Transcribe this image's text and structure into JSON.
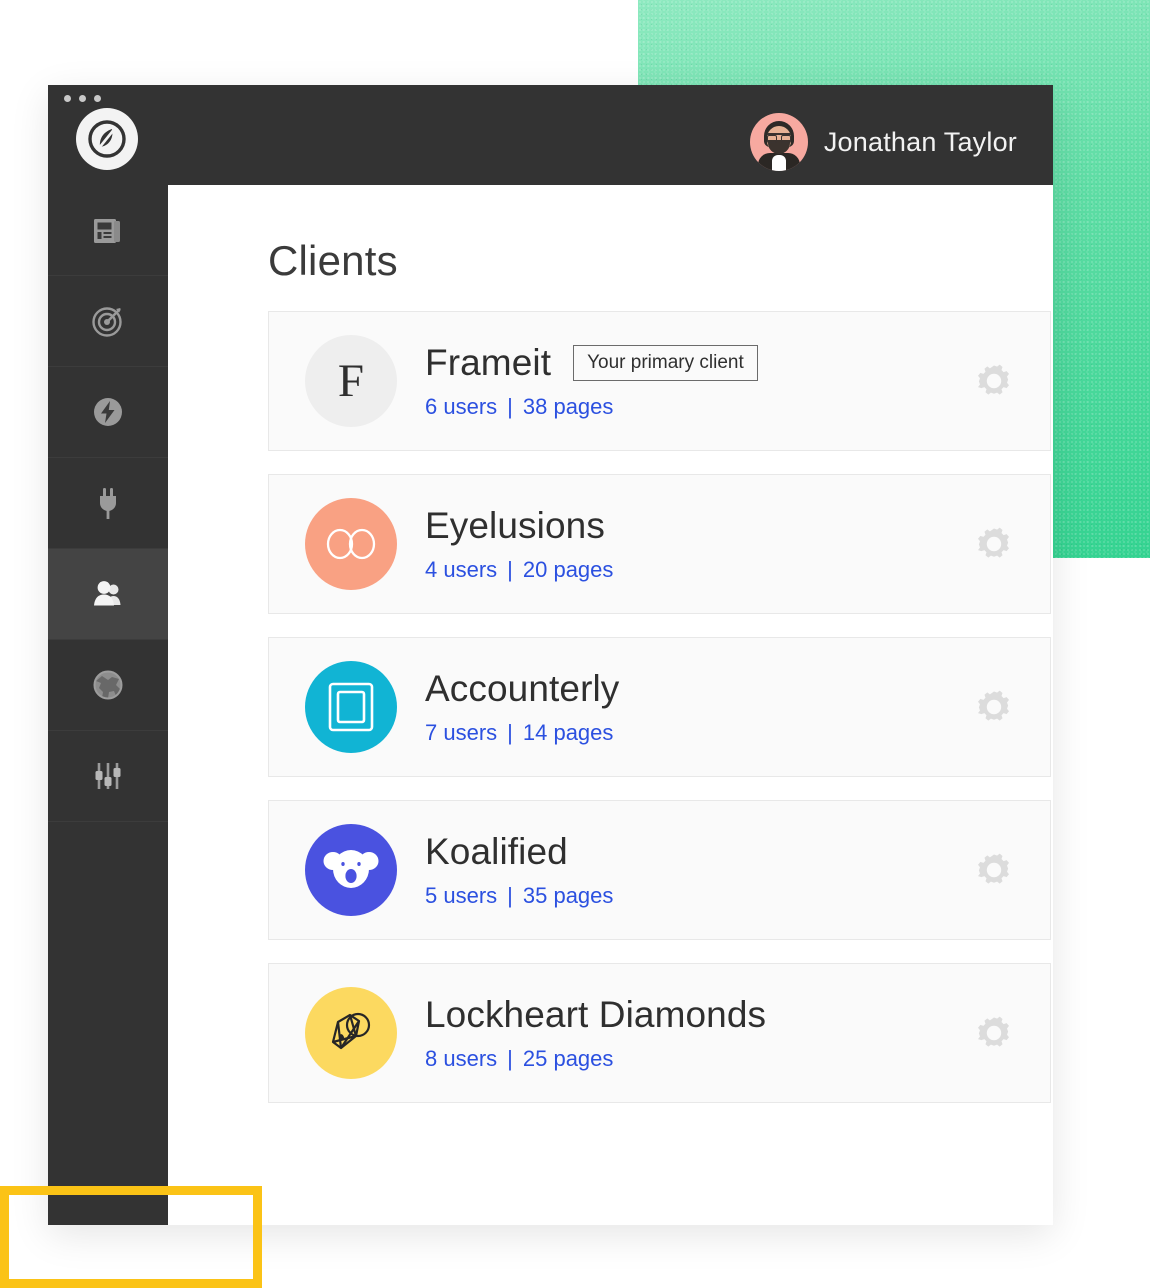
{
  "decor": {
    "green_block_color": "#34d391",
    "yellow_frame_color": "#fbc316"
  },
  "window": {
    "chrome_color": "#333333",
    "dots": [
      "dot",
      "dot",
      "dot"
    ]
  },
  "header": {
    "user_name": "Jonathan Taylor",
    "avatar_bg": "#f7a9a0"
  },
  "sidebar": {
    "logo_name": "app-logo",
    "items": [
      {
        "icon": "newspaper-icon",
        "name": "sidebar-item-content",
        "active": false
      },
      {
        "icon": "target-icon",
        "name": "sidebar-item-goals",
        "active": false
      },
      {
        "icon": "lightning-icon",
        "name": "sidebar-item-automation",
        "active": false
      },
      {
        "icon": "plug-icon",
        "name": "sidebar-item-integrations",
        "active": false
      },
      {
        "icon": "people-icon",
        "name": "sidebar-item-clients",
        "active": true
      },
      {
        "icon": "globe-icon",
        "name": "sidebar-item-sites",
        "active": false
      },
      {
        "icon": "sliders-icon",
        "name": "sidebar-item-settings",
        "active": false
      }
    ]
  },
  "main": {
    "title": "Clients",
    "gear_label": "gear-icon",
    "separator": "|",
    "clients": [
      {
        "name": "Frameit",
        "badge": "Your primary client",
        "users": "6 users",
        "pages": "38 pages",
        "logo_bg": "#eeeeee",
        "logo_type": "letter-f"
      },
      {
        "name": "Eyelusions",
        "badge": "",
        "users": "4 users",
        "pages": "20 pages",
        "logo_bg": "#f9a183",
        "logo_type": "eyes"
      },
      {
        "name": "Accounterly",
        "badge": "",
        "users": "7 users",
        "pages": "14 pages",
        "logo_bg": "#11b4d4",
        "logo_type": "frames"
      },
      {
        "name": "Koalified",
        "badge": "",
        "users": "5 users",
        "pages": "35 pages",
        "logo_bg": "#4a52e0",
        "logo_type": "koala"
      },
      {
        "name": "Lockheart Diamonds",
        "badge": "",
        "users": "8 users",
        "pages": "25 pages",
        "logo_bg": "#fcd960",
        "logo_type": "gem"
      }
    ]
  }
}
